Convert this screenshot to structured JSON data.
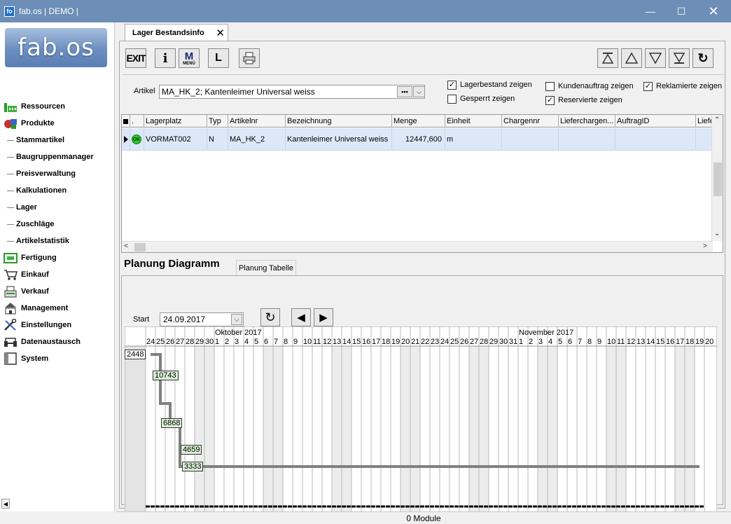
{
  "window": {
    "title": "fab.os | DEMO |",
    "app_icon": "fo"
  },
  "logo": "fab.os",
  "sidebar": {
    "items": [
      {
        "label": "Ressourcen",
        "icon": "factory-icon"
      },
      {
        "label": "Produkte",
        "icon": "products-icon"
      },
      {
        "label": "Stammartikel"
      },
      {
        "label": "Baugruppenmanager"
      },
      {
        "label": "Preisverwaltung"
      },
      {
        "label": "Kalkulationen"
      },
      {
        "label": "Lager"
      },
      {
        "label": "Zuschläge"
      },
      {
        "label": "Artikelstatistik"
      },
      {
        "label": "Fertigung",
        "icon": "fertigung-icon"
      },
      {
        "label": "Einkauf",
        "icon": "cart-icon"
      },
      {
        "label": "Verkauf",
        "icon": "register-icon"
      },
      {
        "label": "Management",
        "icon": "management-icon"
      },
      {
        "label": "Einstellungen",
        "icon": "tools-icon"
      },
      {
        "label": "Datenaustausch",
        "icon": "exchange-icon"
      },
      {
        "label": "System",
        "icon": "system-icon"
      }
    ]
  },
  "tab": {
    "label": "Lager Bestandsinfo"
  },
  "toolbar": {
    "exit": "EXIT",
    "info": "i",
    "menu": "M",
    "menu_sub": "MENÜ",
    "list": "L"
  },
  "filter": {
    "artikel_label": "Artikel",
    "artikel_value": "MA_HK_2; Kantenleimer Universal weiss",
    "dots": "•••",
    "checkboxes": {
      "lagerbestand": {
        "label": "Lagerbestand zeigen",
        "checked": true
      },
      "gesperrt": {
        "label": "Gesperrt zeigen",
        "checked": false
      },
      "kundenauftrag": {
        "label": "Kundenauftrag zeigen",
        "checked": false
      },
      "reserviert": {
        "label": "Reservierte zeigen",
        "checked": true
      },
      "reklamiert": {
        "label": "Reklamierte zeigen",
        "checked": true
      }
    }
  },
  "grid": {
    "headers": [
      ".",
      "Lagerplatz",
      "Typ",
      "Artikelnr",
      "Bezeichnung",
      "Menge",
      "Einheit",
      "Chargennr",
      "Lieferchargen...",
      "AuftragID",
      "Liefe"
    ],
    "row": {
      "status": "OK",
      "lagerplatz": "VORMAT002",
      "typ": "N",
      "artikelnr": "MA_HK_2",
      "bezeichnung": "Kantenleimer Universal weiss",
      "menge": "12447,600",
      "einheit": "m"
    }
  },
  "planning": {
    "tab_diagram": "Planung Diagramm",
    "tab_table": "Planung Tabelle",
    "start_label": "Start",
    "start_value": "24.09.2017"
  },
  "chart_data": {
    "type": "line",
    "month_labels": [
      "Oktober 2017",
      "November 2017"
    ],
    "day_labels": [
      "24",
      "25",
      "26",
      "27",
      "28",
      "29",
      "30",
      "1",
      "2",
      "3",
      "4",
      "5",
      "6",
      "7",
      "8",
      "9",
      "10",
      "11",
      "12",
      "13",
      "14",
      "15",
      "16",
      "17",
      "18",
      "19",
      "20",
      "21",
      "22",
      "23",
      "24",
      "25",
      "26",
      "27",
      "28",
      "29",
      "30",
      "31",
      "1",
      "2",
      "3",
      "4",
      "5",
      "6",
      "7",
      "8",
      "9",
      "10",
      "11",
      "12",
      "13",
      "14",
      "15",
      "16",
      "17",
      "18",
      "19",
      "20"
    ],
    "value_labels": [
      "2448",
      "10743",
      "6868",
      "4659",
      "3333"
    ]
  },
  "status": {
    "modules": "0 Module"
  }
}
